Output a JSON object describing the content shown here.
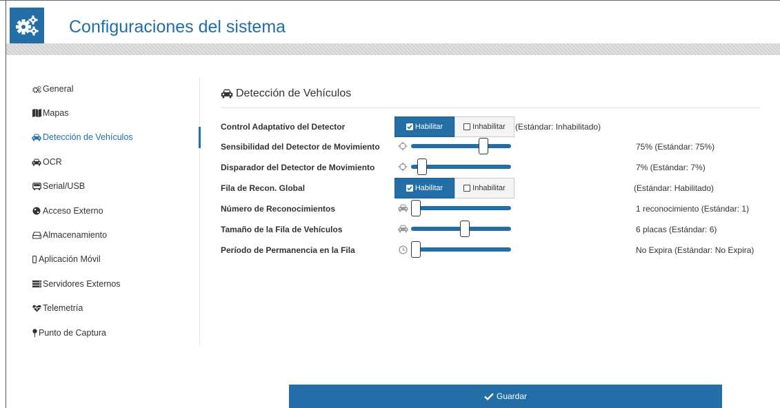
{
  "header": {
    "title": "Configuraciones del sistema",
    "logo_icon": "gears-icon"
  },
  "colors": {
    "accent": "#236ea6",
    "track": "#1f6ea8"
  },
  "sidebar": {
    "items": [
      {
        "label": "General",
        "icon": "gears-icon"
      },
      {
        "label": "Mapas",
        "icon": "map-icon"
      },
      {
        "label": "Detección de Vehículos",
        "icon": "car-icon",
        "active": true
      },
      {
        "label": "OCR",
        "icon": "car-icon"
      },
      {
        "label": "Serial/USB",
        "icon": "bus-icon"
      },
      {
        "label": "Acceso Externo",
        "icon": "globe-icon"
      },
      {
        "label": "Almacenamiento",
        "icon": "hdd-icon"
      },
      {
        "label": "Aplicación Móvil",
        "icon": "mobile-icon"
      },
      {
        "label": "Servidores Externos",
        "icon": "server-icon"
      },
      {
        "label": "Telemetría",
        "icon": "heartbeat-icon"
      },
      {
        "label": "Punto de Captura",
        "icon": "map-pin-icon"
      }
    ]
  },
  "section": {
    "title": "Detección de Vehículos",
    "icon": "car-icon"
  },
  "rows": {
    "control_adaptativo": {
      "label": "Control Adaptativo del Detector",
      "enable": "Habilitar",
      "disable": "Inhabilitar",
      "selected": "Habilitar",
      "default_text": "(Estándar: Inhabilitado)"
    },
    "sensibilidad": {
      "label": "Sensibilidad del Detector de Movimiento",
      "icon": "crosshairs-icon",
      "value_fraction": 0.75,
      "value_text": "75%  (Estándar: 75%)"
    },
    "disparador": {
      "label": "Disparador del Detector de Movimiento",
      "icon": "crosshairs-icon",
      "value_fraction": 0.07,
      "value_text": "7%  (Estándar: 7%)"
    },
    "fila_global": {
      "label": "Fila de Recon. Global",
      "enable": "Habilitar",
      "disable": "Inhabilitar",
      "selected": "Habilitar",
      "default_text": "(Estándar: Habilitado)"
    },
    "num_reconocimientos": {
      "label": "Número de Reconocimientos",
      "icon": "car-icon",
      "value_fraction": 0.0,
      "value_text": "1 reconocimiento  (Estándar: 1)"
    },
    "tamano_fila": {
      "label": "Tamaño de la Fila de Vehículos",
      "icon": "car-icon",
      "value_fraction": 0.54,
      "value_text": "6 placas  (Estándar: 6)"
    },
    "periodo": {
      "label": "Período de Permanencia en la Fila",
      "icon": "clock-icon",
      "value_fraction": 0.0,
      "value_text": "No Expira  (Estándar: No Expira)"
    }
  },
  "footer": {
    "save_label": "Guardar",
    "save_icon": "check-icon"
  }
}
